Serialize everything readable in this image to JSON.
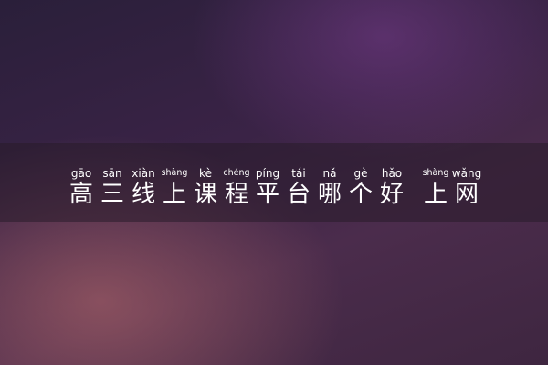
{
  "title": {
    "groups": [
      {
        "chars": [
          {
            "hanzi": "高",
            "pinyin": "gāo"
          },
          {
            "hanzi": "三",
            "pinyin": "sān"
          },
          {
            "hanzi": "线",
            "pinyin": "xiàn"
          },
          {
            "hanzi": "上",
            "pinyin": "shàng"
          },
          {
            "hanzi": "课",
            "pinyin": "kè"
          },
          {
            "hanzi": "程",
            "pinyin": "chéng"
          },
          {
            "hanzi": "平",
            "pinyin": "píng"
          },
          {
            "hanzi": "台",
            "pinyin": "tái"
          },
          {
            "hanzi": "哪",
            "pinyin": "nǎ"
          },
          {
            "hanzi": "个",
            "pinyin": "gè"
          },
          {
            "hanzi": "好",
            "pinyin": "hǎo"
          }
        ]
      },
      {
        "chars": [
          {
            "hanzi": "上",
            "pinyin": "shàng"
          },
          {
            "hanzi": "网",
            "pinyin": "wǎng"
          }
        ]
      }
    ]
  },
  "colors": {
    "text": "#ffffff",
    "band": "#281c2a"
  }
}
